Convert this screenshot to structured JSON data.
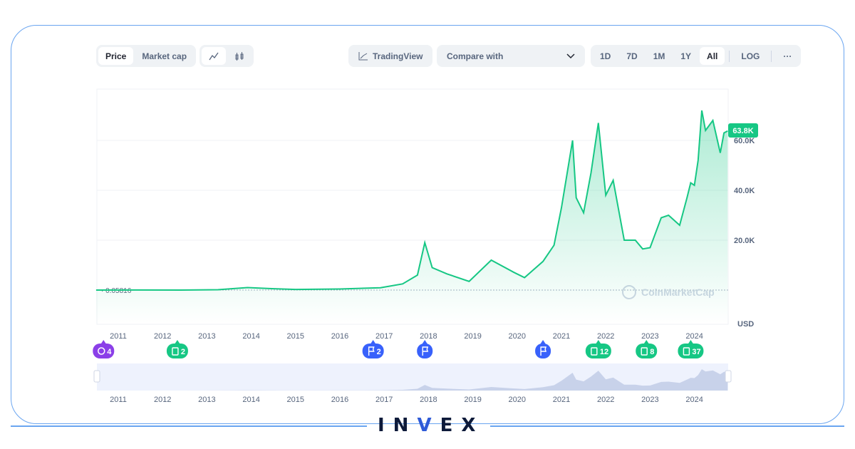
{
  "toolbar": {
    "metric_tabs": [
      "Price",
      "Market cap"
    ],
    "active_metric": "Price",
    "chart_icons": [
      "line-chart-icon",
      "candlestick-icon"
    ],
    "tradingview": "TradingView",
    "compare": "Compare with",
    "ranges": [
      "1D",
      "7D",
      "1M",
      "1Y",
      "All"
    ],
    "active_range": "All",
    "log": "LOG",
    "more": "···"
  },
  "chart_data": {
    "type": "area",
    "ylabel": "USD",
    "yticks": [
      "20.0K",
      "40.0K",
      "60.0K"
    ],
    "ytick_values": [
      20000,
      40000,
      60000
    ],
    "ylim": [
      0,
      80000
    ],
    "xticks": [
      "2011",
      "2012",
      "2013",
      "2014",
      "2015",
      "2016",
      "2017",
      "2018",
      "2019",
      "2020",
      "2021",
      "2022",
      "2023",
      "2024"
    ],
    "start_label": "0.05816",
    "current_label": "63.8K",
    "watermark": "CoinMarketCap",
    "color": "#16c784",
    "grid": true,
    "series": [
      {
        "x": [
          "2010-07",
          "2011-06",
          "2012-06",
          "2013-04",
          "2013-12",
          "2014-06",
          "2015-01",
          "2016-01",
          "2016-12",
          "2017-06",
          "2017-10",
          "2017-12",
          "2018-02",
          "2018-06",
          "2018-12",
          "2019-06",
          "2019-12",
          "2020-03",
          "2020-08",
          "2020-11",
          "2021-01",
          "2021-04",
          "2021-05",
          "2021-07",
          "2021-09",
          "2021-11",
          "2022-01",
          "2022-03",
          "2022-06",
          "2022-09",
          "2022-11",
          "2023-01",
          "2023-04",
          "2023-06",
          "2023-09",
          "2023-11",
          "2023-12",
          "2024-01",
          "2024-02",
          "2024-03",
          "2024-04",
          "2024-06",
          "2024-08",
          "2024-09",
          "2024-10"
        ],
        "y": [
          0.06,
          15,
          6,
          140,
          1000,
          600,
          250,
          430,
          950,
          2500,
          6000,
          19000,
          9000,
          6500,
          3500,
          12000,
          7200,
          5000,
          11500,
          18000,
          33000,
          60000,
          37000,
          31000,
          47000,
          67000,
          38000,
          44000,
          20000,
          20000,
          16500,
          17000,
          29000,
          30000,
          26000,
          37000,
          43000,
          42000,
          52000,
          72000,
          64000,
          68000,
          55000,
          63000,
          63800
        ]
      }
    ]
  },
  "events": [
    {
      "icon": "clock-icon",
      "count": "4",
      "color": "#8b3fe8",
      "year": "2010-09"
    },
    {
      "icon": "document-icon",
      "count": "2",
      "color": "#16c784",
      "year": "2012-05"
    },
    {
      "icon": "flag-icon",
      "count": "2",
      "color": "#3861fb",
      "year": "2016-10"
    },
    {
      "icon": "flag-icon",
      "count": "",
      "color": "#3861fb",
      "year": "2017-12"
    },
    {
      "icon": "flag-icon",
      "count": "",
      "color": "#3861fb",
      "year": "2020-08"
    },
    {
      "icon": "document-icon",
      "count": "12",
      "color": "#16c784",
      "year": "2021-11"
    },
    {
      "icon": "document-icon",
      "count": "8",
      "color": "#16c784",
      "year": "2022-12"
    },
    {
      "icon": "document-icon",
      "count": "37",
      "color": "#16c784",
      "year": "2023-12"
    }
  ],
  "brand": "INVEX"
}
